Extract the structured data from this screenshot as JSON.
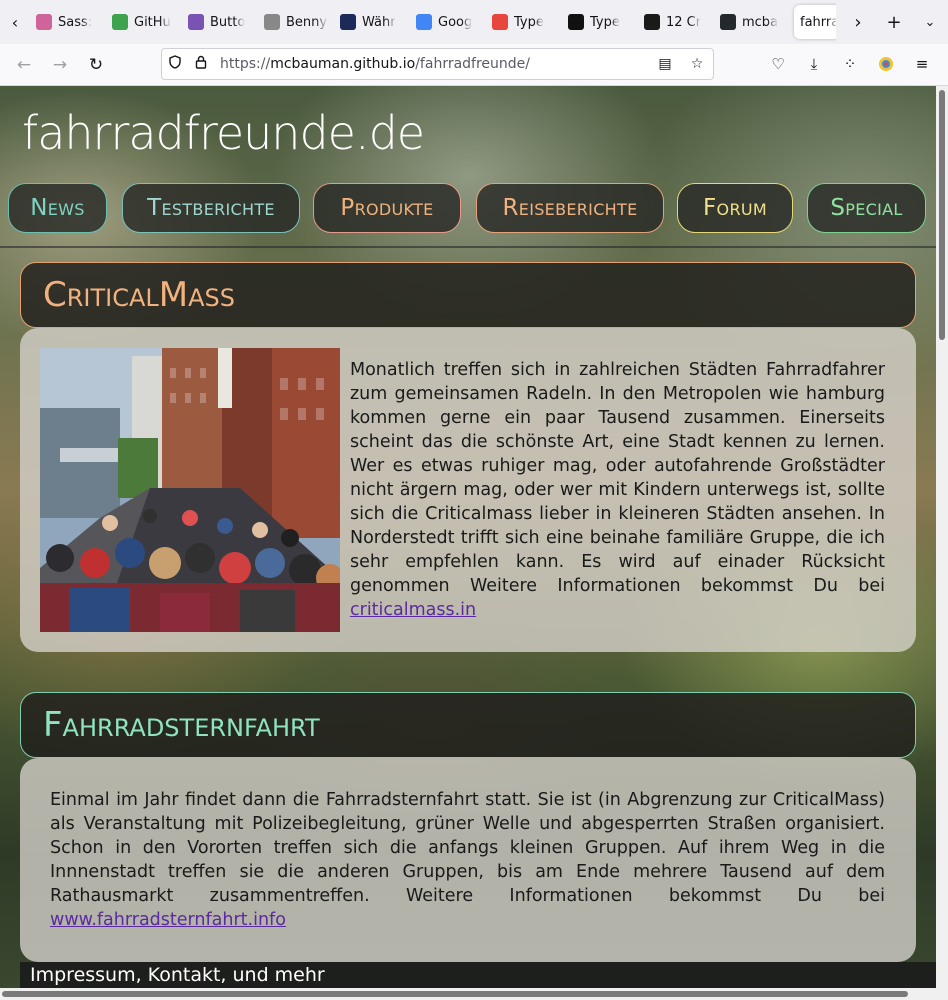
{
  "browser": {
    "tabs": [
      {
        "label": "Sass:",
        "icon": "sass-icon",
        "color": "#cf649a"
      },
      {
        "label": "GitHu",
        "icon": "github-icon",
        "color": "#3fa34d"
      },
      {
        "label": "Butto",
        "icon": "bootstrap-icon",
        "color": "#7952b3"
      },
      {
        "label": "Benny's",
        "icon": "page-icon",
        "color": "#888888"
      },
      {
        "label": "Währ",
        "icon": "xe-currency-icon",
        "color": "#1c2a5a"
      },
      {
        "label": "Goog",
        "icon": "google-translate-icon",
        "color": "#4285f4"
      },
      {
        "label": "Type",
        "icon": "asterisk-icon",
        "color": "#e8453c"
      },
      {
        "label": "Type",
        "icon": "typescale-icon",
        "color": "#111111"
      },
      {
        "label": "12 Cr",
        "icon": "codrops-icon",
        "color": "#1a1a1a"
      },
      {
        "label": "mcba",
        "icon": "github-icon",
        "color": "#24292e"
      },
      {
        "label": "fahrra",
        "icon": "",
        "color": "",
        "active": true
      }
    ],
    "url_host": "mcbauman.github.io",
    "url_path": "/fahrradfreunde/",
    "url_prefix": "https://"
  },
  "site": {
    "title": "fahrradfreunde.de",
    "menu": [
      {
        "label": "News",
        "color": "#7fd3c4",
        "border": "#6cbfae"
      },
      {
        "label": "Testberichte",
        "color": "#9fd6d0",
        "border": "#7cc0b8"
      },
      {
        "label": "Produkte",
        "color": "#f0b27a",
        "border": "#e39a8a"
      },
      {
        "label": "Reiseberichte",
        "color": "#f2b27f",
        "border": "#e2a27a"
      },
      {
        "label": "Forum",
        "color": "#f0e08a",
        "border": "#e5d77a"
      },
      {
        "label": "Special",
        "color": "#8fe3a0",
        "border": "#7fd090"
      }
    ]
  },
  "articles": [
    {
      "title": "CriticalMass",
      "title_color": "#f2b27f",
      "border": "#e8a070",
      "text": "Monatlich treffen sich in zahlreichen Städten Fahrradfahrer zum gemeinsamen Radeln. In den Metropolen wie hamburg kommen gerne ein paar Tausend zusammen. Einerseits scheint das die schönste Art, eine Stadt kennen zu lernen. Wer es etwas ruhiger mag, oder autofahrende Großstädter nicht ärgern mag, oder wer mit Kindern unterwegs ist, sollte sich die Criticalmass lieber in kleineren Städten ansehen. In Norderstedt trifft sich eine beinahe familiäre Gruppe, die ich sehr empfehlen kann. Es wird auf einader Rücksicht genommen Weitere Informationen bekommst Du bei ",
      "link": "criticalmass.in"
    },
    {
      "title": "Fahrradsternfahrt",
      "title_color": "#8fe3c0",
      "border": "#7fd0b0",
      "text": "Einmal im Jahr findet dann die Fahrradsternfahrt statt. Sie ist (in Abgrenzung zur CriticalMass) als Veranstaltung mit Polizeibegleitung, grüner Welle und abgesperrten Straßen organisiert. Schon in den Vororten treffen sich die anfangs kleinen Gruppen. Auf ihrem Weg in die Innnenstadt treffen sie die anderen Gruppen, bis am Ende mehrere Tausend auf dem Rathausmarkt zusammentreffen. Weitere Informationen bekommst Du bei ",
      "link": "www.fahrradsternfahrt.info"
    }
  ],
  "footer": {
    "text": "Impressum, Kontakt, und mehr"
  }
}
